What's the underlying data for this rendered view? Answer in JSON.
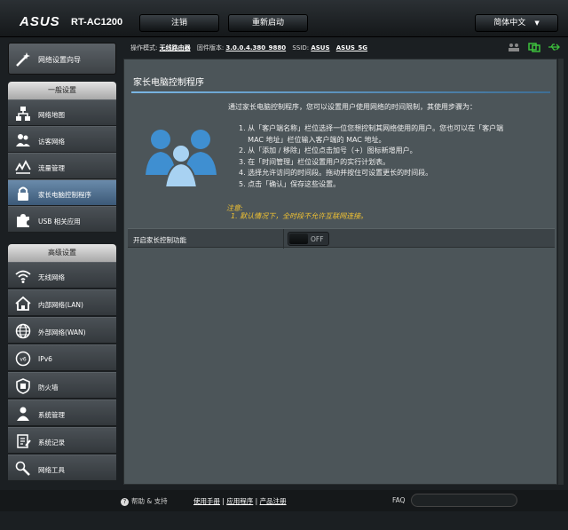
{
  "header": {
    "brand": "ASUS",
    "model": "RT-AC1200",
    "logout_label": "注销",
    "reboot_label": "重新启动",
    "language_label": "简体中文"
  },
  "status": {
    "mode_label": "操作模式:",
    "mode_value": "无线路由器",
    "firmware_label": "固件版本:",
    "firmware_value": "3.0.0.4.380_9880",
    "ssid_label": "SSID:",
    "ssid_values": [
      "ASUS",
      "ASUS_5G"
    ]
  },
  "sidebar": {
    "wizard_label": "网络设置向导",
    "general_header": "一般设置",
    "general_items": [
      {
        "label": "网络地图",
        "icon": "network-map-icon"
      },
      {
        "label": "访客网络",
        "icon": "guest-network-icon"
      },
      {
        "label": "流量管理",
        "icon": "traffic-icon"
      },
      {
        "label": "家长电脑控制程序",
        "icon": "lock-icon",
        "active": true
      },
      {
        "label": "USB 相关应用",
        "icon": "puzzle-icon"
      }
    ],
    "advanced_header": "高级设置",
    "advanced_items": [
      {
        "label": "无线网络",
        "icon": "wifi-icon"
      },
      {
        "label": "内部网络(LAN)",
        "icon": "home-icon"
      },
      {
        "label": "外部网络(WAN)",
        "icon": "globe-icon"
      },
      {
        "label": "IPv6",
        "icon": "ipv6-icon"
      },
      {
        "label": "防火墙",
        "icon": "shield-icon"
      },
      {
        "label": "系统管理",
        "icon": "admin-icon"
      },
      {
        "label": "系统记录",
        "icon": "log-icon"
      },
      {
        "label": "网络工具",
        "icon": "tools-icon"
      }
    ]
  },
  "main": {
    "title": "家长电脑控制程序",
    "intro": "通过家长电脑控制程序，您可以设置用户使用网络的时间限制，其使用步骤为：",
    "steps": [
      "1. 从「客户端名称」栏位选择一位您想控制其网络使用的用户。您也可以在「客户端",
      "    MAC 地址」栏位输入客户端的 MAC 地址。",
      "2. 从「添加 / 移除」栏位点击加号（+）图标新增用户。",
      "3. 在「时间管理」栏位设置用户的实行计划表。",
      "4. 选择允许访问的时间段。拖动并按住可设置更长的时间段。",
      "5. 点击「确认」保存这些设置。"
    ],
    "note_title": "注意:",
    "note_text": "1. 默认情况下，全时段不允许互联网连接。",
    "setting_label": "开启家长控制功能",
    "toggle_state": "OFF"
  },
  "footer": {
    "help_label": "帮助 & 支持",
    "links": [
      "使用手册",
      "应用程序",
      "产品注册"
    ],
    "faq_label": "FAQ"
  }
}
